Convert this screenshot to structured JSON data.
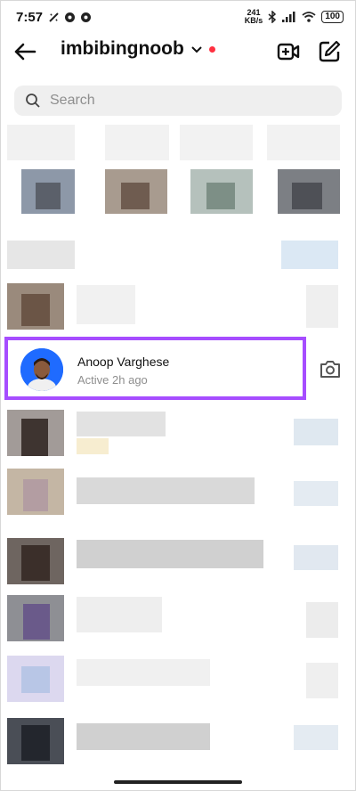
{
  "status_bar": {
    "time": "7:57",
    "speed_value": "241",
    "speed_unit": "KB/s",
    "battery": "100"
  },
  "header": {
    "username": "imbibingnoob",
    "chevron": "⌄",
    "icons": {
      "back": "arrow-left-icon",
      "video": "video-plus-icon",
      "compose": "compose-icon"
    }
  },
  "search": {
    "placeholder": "Search"
  },
  "highlighted_chat": {
    "name": "Anoop Varghese",
    "status": "Active 2h ago"
  },
  "colors": {
    "highlight_border": "#a64dff",
    "avatar_bg": "#1f6bff",
    "notification_dot": "#ff3040"
  }
}
